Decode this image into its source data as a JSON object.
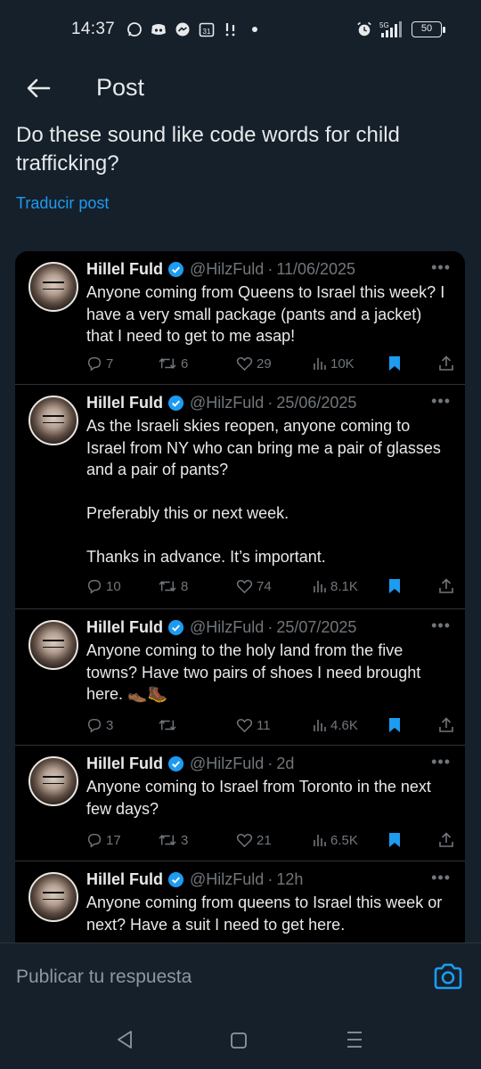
{
  "status": {
    "time": "14:37",
    "battery": "50",
    "network": "5G"
  },
  "header": {
    "title": "Post"
  },
  "post": {
    "text": "Do these sound like code words for child trafficking?",
    "translate": "Traducir post"
  },
  "tweets": [
    {
      "name": "Hillel Fuld",
      "handle": "@HilzFuld",
      "date": "11/06/2025",
      "text": "Anyone coming from Queens to Israel this week? I have a very small package (pants and a jacket) that I need to get to me asap!",
      "replies": "7",
      "retweets": "6",
      "likes": "29",
      "views": "10K"
    },
    {
      "name": "Hillel Fuld",
      "handle": "@HilzFuld",
      "date": "25/06/2025",
      "text": "As the Israeli skies reopen, anyone coming to Israel from NY who can bring me a pair of glasses and a pair of pants?\n\nPreferably this or next week.\n\nThanks in advance. It’s important.",
      "replies": "10",
      "retweets": "8",
      "likes": "74",
      "views": "8.1K"
    },
    {
      "name": "Hillel Fuld",
      "handle": "@HilzFuld",
      "date": "25/07/2025",
      "text": "Anyone coming to the holy land from the five towns? Have two pairs of shoes I need brought here. 👞🥾",
      "replies": "3",
      "retweets": "",
      "likes": "11",
      "views": "4.6K"
    },
    {
      "name": "Hillel Fuld",
      "handle": "@HilzFuld",
      "date": "2d",
      "text": "Anyone coming to Israel from Toronto in the next few days?",
      "replies": "17",
      "retweets": "3",
      "likes": "21",
      "views": "6.5K"
    },
    {
      "name": "Hillel Fuld",
      "handle": "@HilzFuld",
      "date": "12h",
      "text": "Anyone coming from queens to Israel this week or next? Have a suit I need to get here."
    }
  ],
  "reply": {
    "placeholder": "Publicar tu respuesta"
  },
  "icons": {
    "accent": "#1d9bf0",
    "muted": "#71767b",
    "back": "arrow-left-icon",
    "camera": "camera-icon",
    "verified": "verified-badge-icon",
    "reply": "reply-icon",
    "retweet": "retweet-icon",
    "like": "heart-icon",
    "views": "views-icon",
    "bookmark": "bookmark-icon",
    "share": "share-icon"
  }
}
